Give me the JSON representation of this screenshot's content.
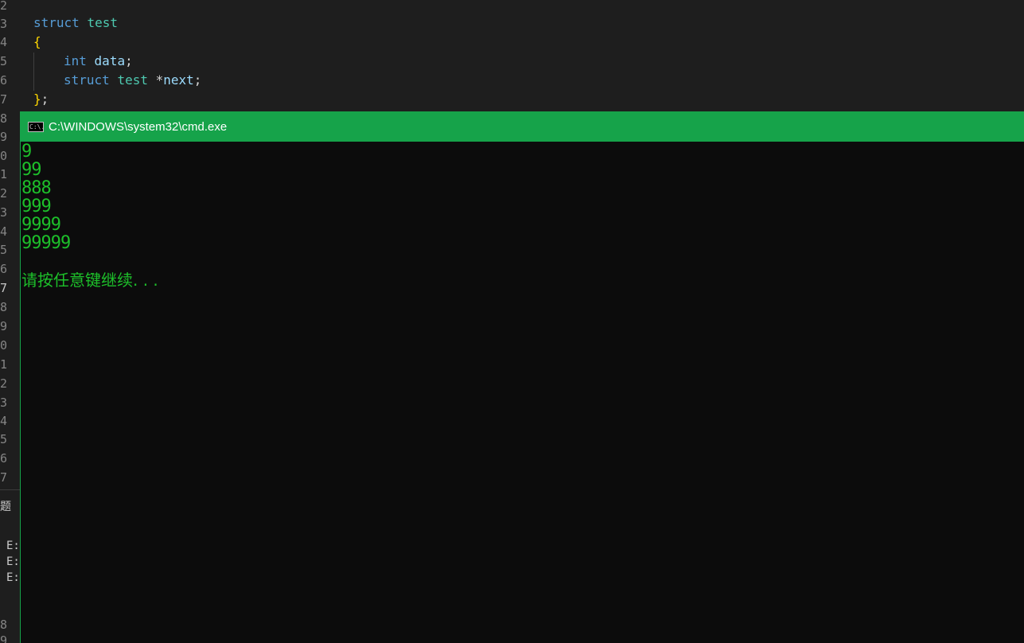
{
  "editor": {
    "line_numbers": [
      "2",
      "3",
      "4",
      "5",
      "6",
      "7",
      "8",
      "9",
      "0",
      "1",
      "2",
      "3",
      "4",
      "5",
      "6",
      "7",
      "8",
      "9",
      "0",
      "1",
      "2",
      "3",
      "4",
      "5",
      "6",
      "7"
    ],
    "code": {
      "l3_kw": "struct",
      "l3_type": "test",
      "l4_brace": "{",
      "l5_kw": "int",
      "l5_var": "data",
      "l5_semi": ";",
      "l6_kw": "struct",
      "l6_type": "test",
      "l6_star": "*",
      "l6_var": "next",
      "l6_semi": ";",
      "l7_brace": "}",
      "l7_semi": ";"
    },
    "panel": {
      "tab_fragment": "题",
      "error_prefix": "E:",
      "bottom_numbers": [
        "8",
        "9"
      ]
    }
  },
  "cmd_window": {
    "title": "C:\\WINDOWS\\system32\\cmd.exe",
    "icon_text": "C:\\.",
    "output_lines": [
      "9",
      "99",
      "888",
      "999",
      "9999",
      "99999"
    ],
    "prompt": "请按任意键继续. . ."
  },
  "colors": {
    "titlebar": "#16a34a",
    "console_text": "#1dbf2a",
    "console_bg": "#0c0c0c",
    "editor_bg": "#1e1e1e"
  }
}
